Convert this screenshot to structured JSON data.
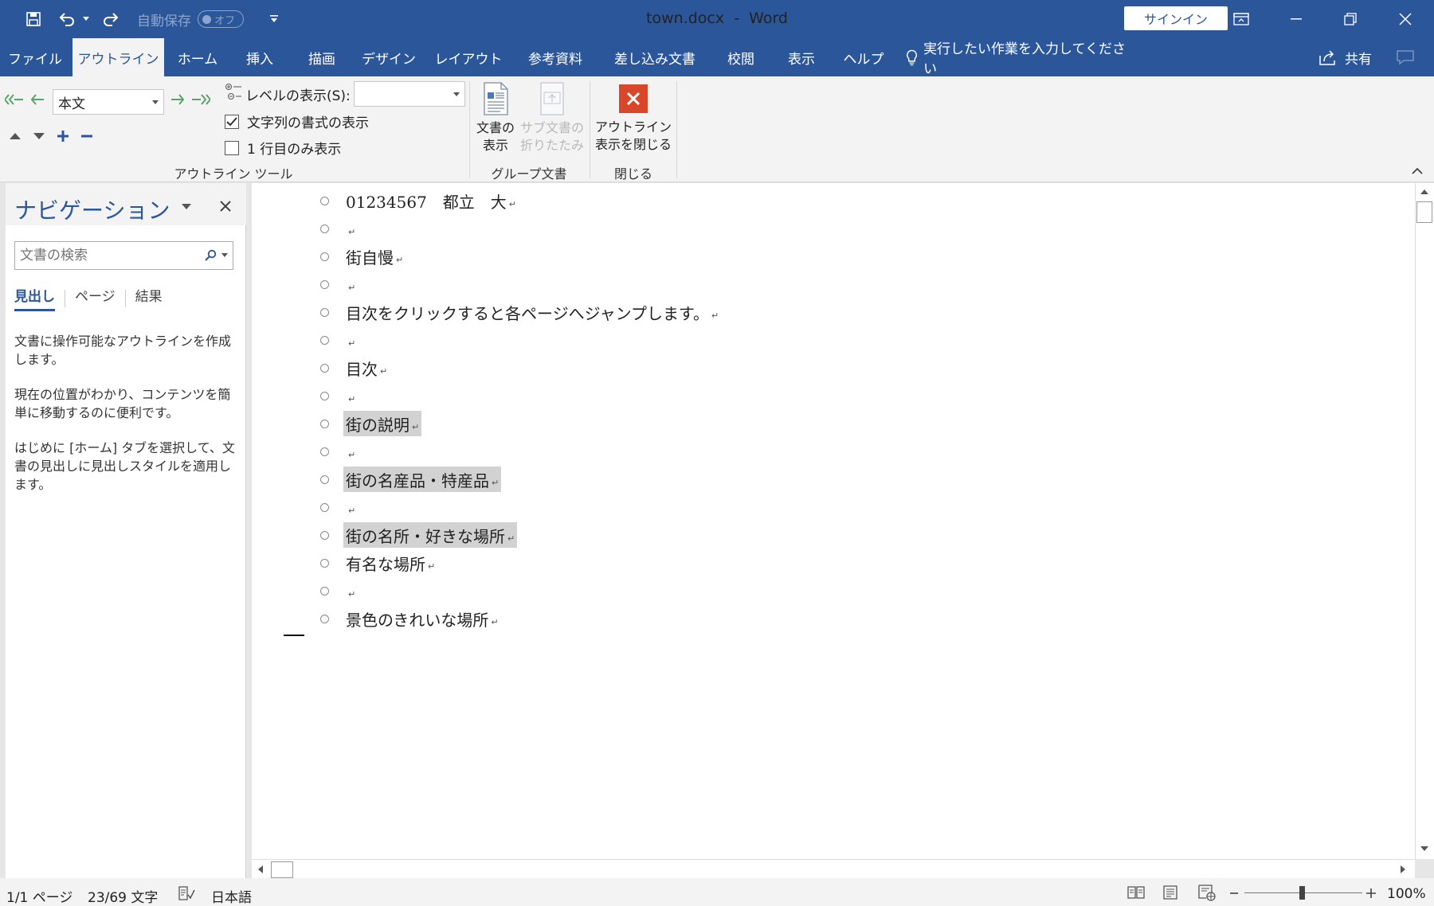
{
  "titlebar": {
    "autosave_label": "自動保存",
    "autosave_state": "オフ",
    "doc_name": "town.docx",
    "separator": "-",
    "app_name": "Word",
    "signin_label": "サインイン"
  },
  "tabs": [
    "ファイル",
    "アウトライン",
    "ホーム",
    "挿入",
    "描画",
    "デザイン",
    "レイアウト",
    "参考資料",
    "差し込み文書",
    "校閲",
    "表示",
    "ヘルプ"
  ],
  "tell_me": "実行したい作業を入力してください",
  "share_label": "共有",
  "ribbon": {
    "level_value": "本文",
    "show_level_label": "レベルの表示(S):",
    "show_level_value": "",
    "show_text_format_label": "文字列の書式の表示",
    "show_text_format_checked": true,
    "first_line_only_label": "1 行目のみ表示",
    "first_line_only_checked": false,
    "group_outline_tools": "アウトライン ツール",
    "show_document_line1": "文書の",
    "show_document_line2": "表示",
    "collapse_subdocs_line1": "サブ文書の",
    "collapse_subdocs_line2": "折りたたみ",
    "group_master_document": "グループ文書",
    "close_outline_line1": "アウトライン",
    "close_outline_line2": "表示を閉じる",
    "group_close": "閉じる"
  },
  "navigation": {
    "title": "ナビゲーション",
    "search_placeholder": "文書の検索",
    "tabs": [
      "見出し",
      "ページ",
      "結果"
    ],
    "info1": "文書に操作可能なアウトラインを作成します。",
    "info2": "現在の位置がわかり、コンテンツを簡単に移動するのに便利です。",
    "info3": "はじめに [ホーム] タブを選択して、文書の見出しに見出しスタイルを適用します。"
  },
  "document": {
    "paragraph_mark": "↵",
    "lines": [
      {
        "text": "01234567　都立　大",
        "highlight": false
      },
      {
        "text": "",
        "highlight": false
      },
      {
        "text": "街自慢",
        "highlight": false
      },
      {
        "text": "",
        "highlight": false
      },
      {
        "text": "目次をクリックすると各ページへジャンプします。",
        "highlight": false
      },
      {
        "text": "",
        "highlight": false
      },
      {
        "text": "目次",
        "highlight": false
      },
      {
        "text": "",
        "highlight": false
      },
      {
        "text": "街の説明",
        "highlight": true
      },
      {
        "text": "",
        "highlight": false
      },
      {
        "text": "街の名産品・特産品",
        "highlight": true
      },
      {
        "text": "",
        "highlight": false
      },
      {
        "text": "街の名所・好きな場所",
        "highlight": true
      },
      {
        "text": "有名な場所",
        "highlight": false
      },
      {
        "text": "",
        "highlight": false
      },
      {
        "text": "景色のきれいな場所",
        "highlight": false
      }
    ]
  },
  "statusbar": {
    "page_info": "1/1 ページ",
    "word_count": "23/69 文字",
    "language": "日本語",
    "zoom": "100%",
    "zoom_level_percent": 100
  },
  "colors": {
    "accent": "#2b579a",
    "close_red": "#d9472b"
  }
}
